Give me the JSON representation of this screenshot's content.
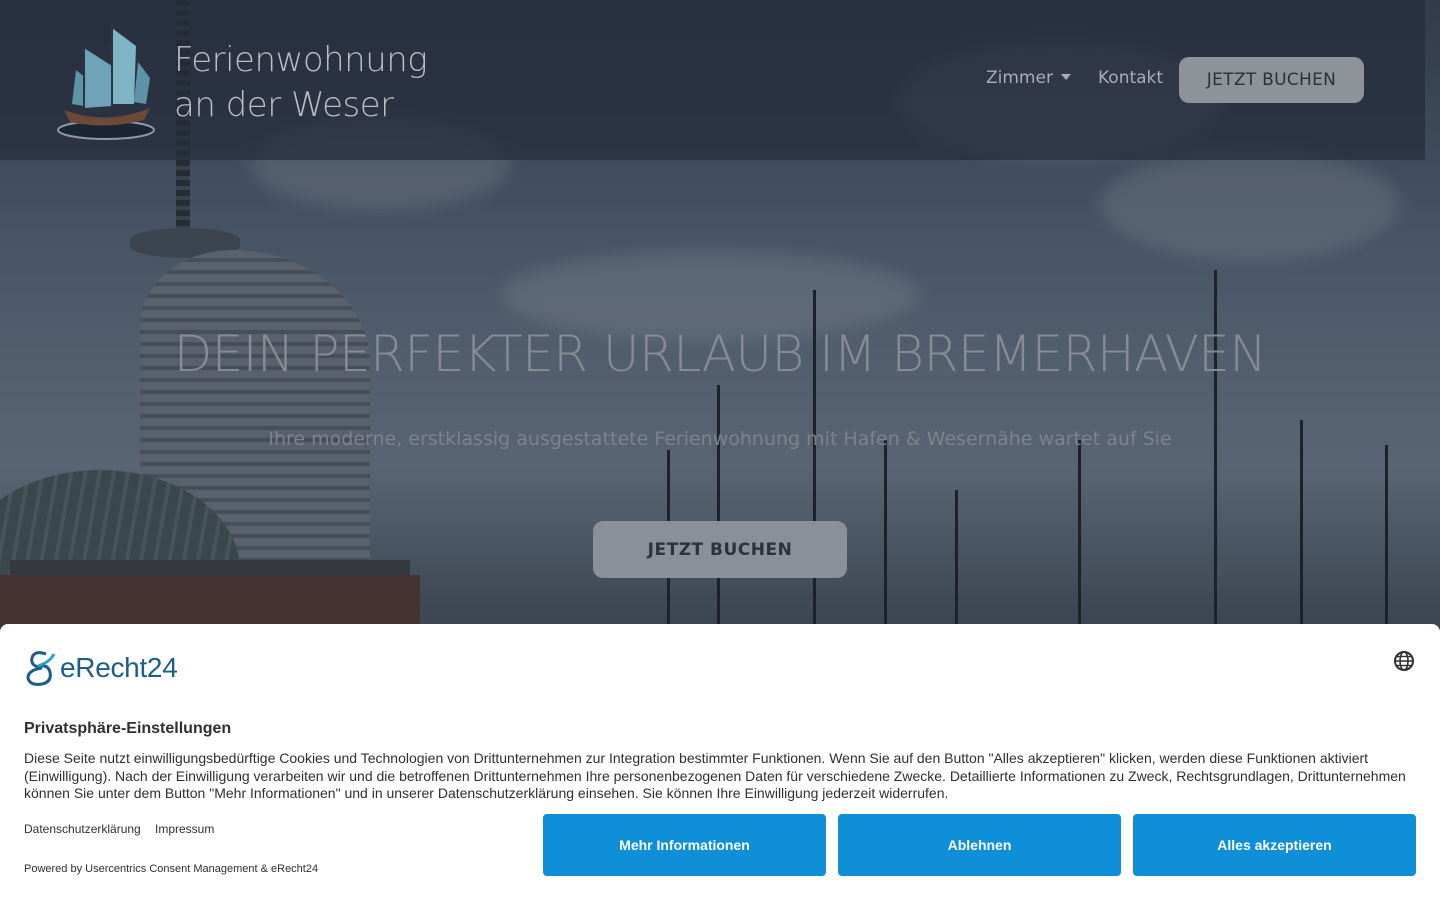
{
  "header": {
    "brand_line1": "Ferienwohnung",
    "brand_line2": "an der Weser",
    "nav": {
      "zimmer": "Zimmer",
      "kontakt": "Kontakt",
      "cta": "JETZT BUCHEN"
    }
  },
  "hero": {
    "title": "DEIN PERFEKTER URLAUB IM BREMERHAVEN",
    "subtitle": "Ihre moderne, erstklassig ausgestattete Ferienwohnung mit Hafen & Wesernähe wartet auf Sie",
    "cta": "JETZT BUCHEN"
  },
  "consent": {
    "logo_text": "eRecht24",
    "title": "Privatsphäre-Einstellungen",
    "body": "Diese Seite nutzt einwilligungsbedürftige Cookies und Technologien von Drittunternehmen zur Integration bestimmter Funktionen. Wenn Sie auf den Button \"Alles akzeptieren\" klicken, werden diese Funktionen aktiviert (Einwilligung). Nach der Einwilligung verarbeiten wir und die betroffenen Drittunternehmen Ihre personenbezogenen Daten für verschiedene Zwecke. Detaillierte Informationen zu Zweck, Rechtsgrundlagen, Drittunternehmen können Sie unter dem Button \"Mehr Informationen\" und in unserer Datenschutzerklärung einsehen. Sie können Ihre Einwilligung jederzeit widerrufen.",
    "links": {
      "privacy": "Datenschutzerklärung",
      "imprint": "Impressum"
    },
    "powered_by": "Powered by Usercentrics Consent Management & eRecht24",
    "buttons": {
      "more_info": "Mehr Informationen",
      "deny": "Ablehnen",
      "accept_all": "Alles akzeptieren"
    },
    "accent_color": "#0f8fd8"
  },
  "icons": {
    "logo": "ship-logo-icon",
    "dropdown": "caret-down-icon",
    "language": "globe-icon"
  }
}
